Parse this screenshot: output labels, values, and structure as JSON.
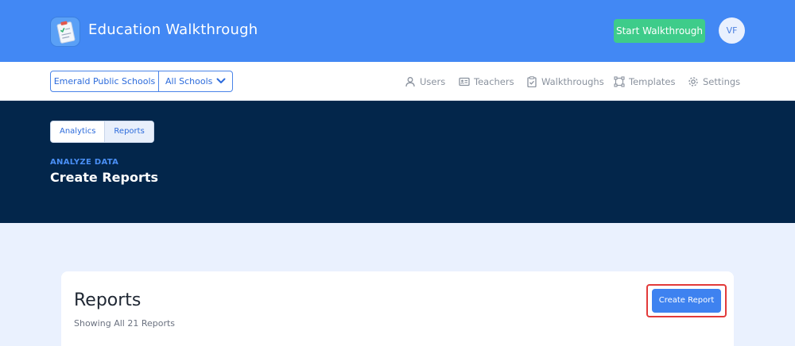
{
  "header": {
    "app_title": "Education Walkthrough",
    "start_button": "Start Walkthrough",
    "avatar_initials": "VF"
  },
  "nav": {
    "district": "Emerald Public Schools",
    "school_filter": "All Schools",
    "items": [
      {
        "label": "Users",
        "icon": "user-icon"
      },
      {
        "label": "Teachers",
        "icon": "id-card-icon"
      },
      {
        "label": "Walkthroughs",
        "icon": "clipboard-check-icon"
      },
      {
        "label": "Templates",
        "icon": "template-icon"
      },
      {
        "label": "Settings",
        "icon": "gear-icon"
      }
    ]
  },
  "hero": {
    "tabs": [
      {
        "label": "Analytics",
        "active": false
      },
      {
        "label": "Reports",
        "active": true
      }
    ],
    "eyebrow": "ANALYZE DATA",
    "title": "Create Reports"
  },
  "card": {
    "title": "Reports",
    "subtitle": "Showing All 21 Reports",
    "create_button": "Create Report"
  },
  "colors": {
    "header_blue": "#4288f4",
    "hero_navy": "#03264b",
    "start_green": "#3ecc8a",
    "highlight_red": "#e23a3a"
  }
}
